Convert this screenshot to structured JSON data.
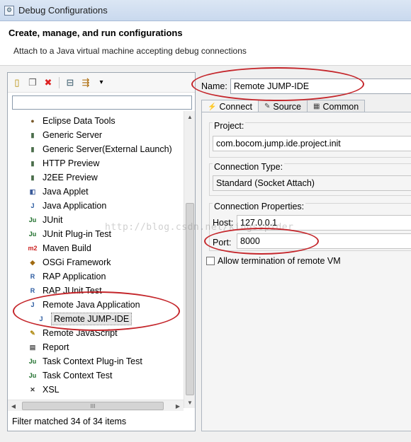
{
  "window": {
    "title": "Debug Configurations",
    "header_title": "Create, manage, and run configurations",
    "header_subtitle": "Attach to a Java virtual machine accepting debug connections"
  },
  "left": {
    "filter_placeholder": "",
    "toolbar": [
      {
        "name": "new-configuration-icon",
        "glyph": "▯"
      },
      {
        "name": "duplicate-icon",
        "glyph": "❐"
      },
      {
        "name": "delete-icon",
        "glyph": "✖"
      },
      {
        "name": "collapse-all-icon",
        "glyph": "⊟"
      },
      {
        "name": "filter-icon",
        "glyph": "⇶"
      },
      {
        "name": "dropdown-arrow-icon",
        "glyph": "▾"
      }
    ],
    "tree": [
      {
        "label": "Eclipse Data Tools",
        "icon": "database-icon",
        "glyph": "●",
        "indent": 0
      },
      {
        "label": "Generic Server",
        "icon": "server-icon",
        "glyph": "▮",
        "indent": 0
      },
      {
        "label": "Generic Server(External Launch)",
        "icon": "server-icon",
        "glyph": "▮",
        "indent": 0
      },
      {
        "label": "HTTP Preview",
        "icon": "server-icon",
        "glyph": "▮",
        "indent": 0
      },
      {
        "label": "J2EE Preview",
        "icon": "server-icon",
        "glyph": "▮",
        "indent": 0
      },
      {
        "label": "Java Applet",
        "icon": "applet-icon",
        "glyph": "◧",
        "indent": 0
      },
      {
        "label": "Java Application",
        "icon": "java-app-icon",
        "glyph": "J",
        "indent": 0
      },
      {
        "label": "JUnit",
        "icon": "junit-icon",
        "glyph": "Ju",
        "indent": 0
      },
      {
        "label": "JUnit Plug-in Test",
        "icon": "junit-plugin-icon",
        "glyph": "Ju",
        "indent": 0
      },
      {
        "label": "Maven Build",
        "icon": "maven-icon",
        "glyph": "m2",
        "indent": 0
      },
      {
        "label": "OSGi Framework",
        "icon": "osgi-icon",
        "glyph": "◆",
        "indent": 0
      },
      {
        "label": "RAP Application",
        "icon": "rap-icon",
        "glyph": "R",
        "indent": 0
      },
      {
        "label": "RAP JUnit Test",
        "icon": "rap-junit-icon",
        "glyph": "R",
        "indent": 0
      },
      {
        "label": "Remote Java Application",
        "icon": "remote-java-icon",
        "glyph": "J",
        "indent": 0
      },
      {
        "label": "Remote JUMP-IDE",
        "icon": "remote-config-icon",
        "glyph": "J",
        "indent": 1,
        "selected": true
      },
      {
        "label": "Remote JavaScript",
        "icon": "javascript-icon",
        "glyph": "✎",
        "indent": 0
      },
      {
        "label": "Report",
        "icon": "report-icon",
        "glyph": "▤",
        "indent": 0
      },
      {
        "label": "Task Context Plug-in Test",
        "icon": "task-plugin-icon",
        "glyph": "Ju",
        "indent": 0
      },
      {
        "label": "Task Context Test",
        "icon": "task-test-icon",
        "glyph": "Ju",
        "indent": 0
      },
      {
        "label": "XSL",
        "icon": "xsl-icon",
        "glyph": "✕",
        "indent": 0
      }
    ],
    "hscroll_thumb_glyph": "III",
    "filter_status": "Filter matched 34 of 34 items"
  },
  "right": {
    "name_label": "Name:",
    "name_value": "Remote JUMP-IDE",
    "tabs": [
      {
        "label": "Connect",
        "icon": "connect-icon",
        "glyph": "⚡",
        "active": true
      },
      {
        "label": "Source",
        "icon": "source-icon",
        "glyph": "✎",
        "active": false
      },
      {
        "label": "Common",
        "icon": "common-icon",
        "glyph": "▦",
        "active": false
      }
    ],
    "project_label": "Project:",
    "project_value": "com.bocom.jump.ide.project.init",
    "connection_type_label": "Connection Type:",
    "connection_type_value": "Standard (Socket Attach)",
    "connection_props_label": "Connection Properties:",
    "host_label": "Host:",
    "host_value": "127.0.0.1",
    "port_label": "Port:",
    "port_value": "8000",
    "allow_termination_label": "Allow termination of remote VM",
    "allow_termination_checked": false
  },
  "watermark": "http://blog.csdn.net/kingsspider",
  "colors": {
    "highlight": "#c4252a"
  }
}
